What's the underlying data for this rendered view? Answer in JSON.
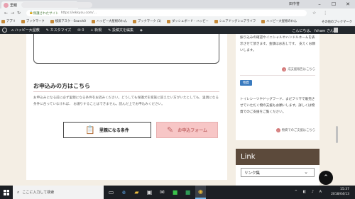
{
  "browser": {
    "tab_title": "里親",
    "window_user": "田中誉",
    "url_secure": "保護されたサイト",
    "url_path": "https://iekkyou.com/...",
    "bookmarks": [
      "アプリ",
      "ブックマーク",
      "検索アスク - Search0",
      "ハッピー大屋根のわん",
      "ブックマーク (1)",
      "ダッシュボード - ハッピー",
      "シニアドッグシニアライフ",
      "ハッピー大屋根のわん"
    ],
    "bookmarks_other": "その他のブックマーク"
  },
  "adminbar": {
    "site": "ハッピー大屋敷",
    "customize": "カスタマイズ",
    "comments": "0",
    "new": "新規",
    "edit": "投稿文を編集",
    "greeting": "こんにちは、 fsham さん"
  },
  "main": {
    "section_title": "お申込みの方はこちら",
    "body": "お申込みになる前に必ず里親になる条件をお読みください。どうしても保護犬を家族に迎えたい方がいたとしても、里親になる条件に合っていなければ、 お譲りすることはできません。読んだ上でお申込みください。",
    "btn_conditions": "里親になる条件",
    "btn_form": "お申込フォーム"
  },
  "sidebar": {
    "top_text": "振り込みの確認やイニシャルやハンドルネームを表示させて頂きます。金額はお志しです。 支えくお願いします。",
    "report_link": "成支援報告はこちら",
    "badge": "物資",
    "body": "トイレシーツやドッグフード、まだフリマで販売させていただく物の支援もお願いします。詳しくは物資でのご支援をご覧ください。",
    "goods_link": "物資でのご支援はこちら"
  },
  "links": {
    "heading": "Link",
    "select_value": "リンク集"
  },
  "taskbar": {
    "search_placeholder": "ここに入力して検索",
    "time": "15:37",
    "date": "2018/04/13"
  }
}
